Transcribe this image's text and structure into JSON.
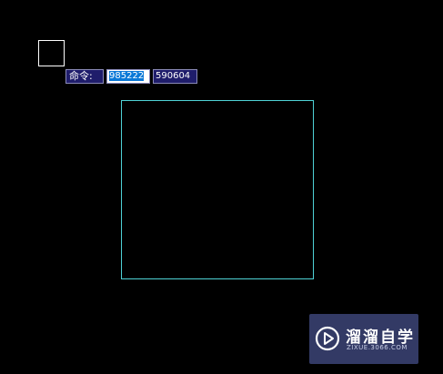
{
  "command_bar": {
    "label": "命令:",
    "x_value": "985222",
    "y_value": "590604"
  },
  "watermark": {
    "title": "溜溜自学",
    "url": "ZIXUE.3066.COM",
    "logo_icon": "play-icon"
  },
  "colors": {
    "canvas": "#000000",
    "rectangle": "#4fd2d6",
    "command_bg": "#1f1d6b",
    "selection": "#0a78d7",
    "watermark_bg": "#373f6e"
  }
}
